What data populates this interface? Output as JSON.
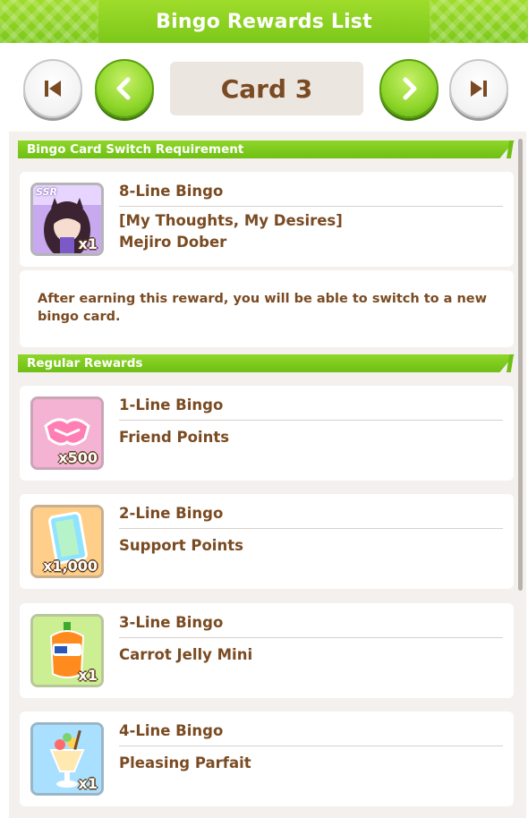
{
  "header": {
    "title": "Bingo Rewards List"
  },
  "nav": {
    "first_icon": "skip-first-icon",
    "prev_icon": "chevron-left-icon",
    "card_label": "Card 3",
    "next_icon": "chevron-right-icon",
    "last_icon": "skip-last-icon"
  },
  "switch_section": {
    "label": "Bingo Card Switch Requirement",
    "reward": {
      "title": "8-Line Bingo",
      "name_line1": "[My Thoughts, My Desires]",
      "name_line2": "Mejiro Dober",
      "qty": "x1",
      "badge": "SSR",
      "icon": "support-card-portrait"
    },
    "note": "After earning this reward, you will be able to switch to a new bingo card."
  },
  "regular_section": {
    "label": "Regular Rewards",
    "items": [
      {
        "title": "1-Line Bingo",
        "name": "Friend Points",
        "qty": "x500",
        "icon": "handshake-icon"
      },
      {
        "title": "2-Line Bingo",
        "name": "Support Points",
        "qty": "x1,000",
        "icon": "support-point-card-icon"
      },
      {
        "title": "3-Line Bingo",
        "name": "Carrot Jelly Mini",
        "qty": "x1",
        "icon": "carrot-jelly-icon"
      },
      {
        "title": "4-Line Bingo",
        "name": "Pleasing Parfait",
        "qty": "x1",
        "icon": "parfait-icon"
      }
    ]
  },
  "colors": {
    "accent_green": "#7cc81a",
    "text_brown": "#7a4b22",
    "panel_bg": "#f3f0ed"
  }
}
